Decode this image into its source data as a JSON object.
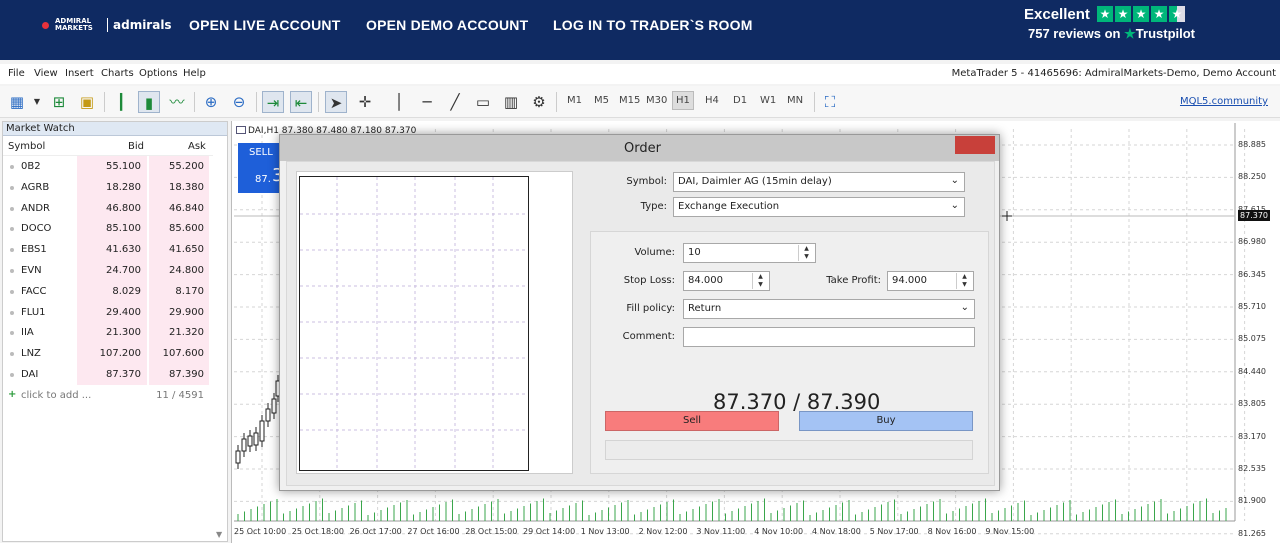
{
  "banner": {
    "logo_small": "ADMIRAL MARKETS",
    "logo_big": "admirals",
    "links": [
      "OPEN LIVE ACCOUNT",
      "OPEN DEMO ACCOUNT",
      "LOG IN TO TRADER`S ROOM"
    ],
    "trustpilot": {
      "rating_text": "Excellent",
      "reviews": "757 reviews on",
      "brand": "Trustpilot",
      "stars": 4.5
    }
  },
  "menu": {
    "items": [
      "File",
      "View",
      "Insert",
      "Charts",
      "Options",
      "Help"
    ],
    "account": "MetaTrader 5 - 41465696: AdmiralMarkets-Demo, Demo Account"
  },
  "toolbar": {
    "timeframes": [
      "M1",
      "M5",
      "M15",
      "M30",
      "H1",
      "H4",
      "D1",
      "W1",
      "MN"
    ],
    "active_timeframe": "H1",
    "community_link": "MQL5.community"
  },
  "market_watch": {
    "title": "Market Watch",
    "headers": {
      "symbol": "Symbol",
      "bid": "Bid",
      "ask": "Ask"
    },
    "rows": [
      {
        "symbol": "0B2",
        "bid": "55.100",
        "ask": "55.200"
      },
      {
        "symbol": "AGRB",
        "bid": "18.280",
        "ask": "18.380"
      },
      {
        "symbol": "ANDR",
        "bid": "46.800",
        "ask": "46.840"
      },
      {
        "symbol": "DOCO",
        "bid": "85.100",
        "ask": "85.600"
      },
      {
        "symbol": "EBS1",
        "bid": "41.630",
        "ask": "41.650"
      },
      {
        "symbol": "EVN",
        "bid": "24.700",
        "ask": "24.800"
      },
      {
        "symbol": "FACC",
        "bid": "8.029",
        "ask": "8.170"
      },
      {
        "symbol": "FLU1",
        "bid": "29.400",
        "ask": "29.900"
      },
      {
        "symbol": "IIA",
        "bid": "21.300",
        "ask": "21.320"
      },
      {
        "symbol": "LNZ",
        "bid": "107.200",
        "ask": "107.600"
      },
      {
        "symbol": "DAI",
        "bid": "87.370",
        "ask": "87.390"
      }
    ],
    "add_text": "click to add ...",
    "count": "11 / 4591"
  },
  "chart": {
    "title": "DAI,H1  87.380 87.480 87.180 87.370",
    "sell_label": "SELL",
    "sell_price_small": "87.",
    "sell_price_big": "3",
    "price_labels": [
      "88.885",
      "88.250",
      "87.615",
      "86.980",
      "86.345",
      "85.710",
      "85.075",
      "84.440",
      "83.805",
      "83.170",
      "82.535",
      "81.900",
      "81.265"
    ],
    "current_price": "87.370",
    "time_labels": [
      "25 Oct 10:00",
      "25 Oct 18:00",
      "26 Oct 17:00",
      "27 Oct 16:00",
      "28 Oct 15:00",
      "29 Oct 14:00",
      "1 Nov 13:00",
      "2 Nov 12:00",
      "3 Nov 11:00",
      "4 Nov 10:00",
      "4 Nov 18:00",
      "5 Nov 17:00",
      "8 Nov 16:00",
      "9 Nov 15:00"
    ]
  },
  "order": {
    "title": "Order",
    "close": "✕",
    "symbol_label": "Symbol:",
    "symbol_value": "DAI, Daimler AG (15min delay)",
    "type_label": "Type:",
    "type_value": "Exchange Execution",
    "volume_label": "Volume:",
    "volume_value": "10",
    "stoploss_label": "Stop Loss:",
    "stoploss_value": "84.000",
    "takeprofit_label": "Take Profit:",
    "takeprofit_value": "94.000",
    "fill_label": "Fill policy:",
    "fill_value": "Return",
    "comment_label": "Comment:",
    "comment_value": "",
    "prices": "87.370 / 87.390",
    "sell_button": "Sell",
    "buy_button": "Buy"
  },
  "colors": {
    "banner": "#0f2a62",
    "trustpilot": "#00b67a",
    "sell": "#f87c7c",
    "buy": "#a4c3f4",
    "close": "#c8403a"
  }
}
